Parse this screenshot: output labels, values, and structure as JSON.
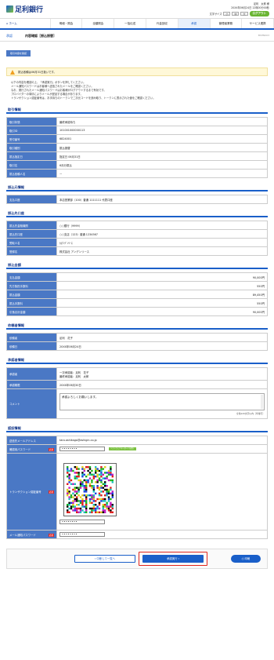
{
  "header": {
    "bank_name": "足利銀行",
    "user_line": "足利　太郎 様",
    "login_line": "20XX年06月24日 12時00分00秒",
    "font_size_label": "文字サイズ",
    "font_small": "小",
    "font_mid": "中",
    "font_large": "大",
    "logout_label": "ログアウト"
  },
  "nav": {
    "home": "ホーム",
    "items": [
      "明細・照会",
      "全額照会",
      "一括伝送",
      "代金回収",
      "承認",
      "管理者業務",
      "サービス連携"
    ]
  },
  "title": {
    "category": "承認",
    "title": "内容確認［振込振替］",
    "code": "BSHN003"
  },
  "step_label": "取引内容を確認",
  "notice": "振込依頼は06月31日扱いです。",
  "intro": [
    "以下の内容を確認の上、「承認実行」ボタンを押してください。",
    "メール通知パスワードはお客様へ送信されたメールをご確認ください。",
    "なお、発行されたメール通知パスワードはお客様がログアウトするまで有効です。",
    "プロバイダーの事情によりメールが遅延する場合があります。",
    "トランザクション認証番号は、お手持ちのトークンで二次元コードを読み取り、トークンに表示された値をご確認ください。"
  ],
  "sections": {
    "txn": {
      "heading": "取引情報",
      "rows": [
        {
          "k": "取引状態",
          "v": "最終承認待ち"
        },
        {
          "k": "取引ID",
          "v": "101001000000113"
        },
        {
          "k": "受付番号",
          "v": "6824001"
        },
        {
          "k": "取引種別",
          "v": "振込振替"
        },
        {
          "k": "振込指定日",
          "v": "指定日 06月31日"
        },
        {
          "k": "取引名",
          "v": "6月分振込"
        },
        {
          "k": "振込依頼人名",
          "v": "ー"
        }
      ]
    },
    "from": {
      "heading": "振込元情報",
      "rows": [
        {
          "k": "支払口座",
          "v": "本店営業部（100）普通 1111111 代表口座"
        }
      ]
    },
    "to": {
      "heading": "振込先口座",
      "rows": [
        {
          "k": "振込先金融機関",
          "v": "○○銀行（9999）"
        },
        {
          "k": "振込先口座",
          "v": "○○支店（123）普通 1234567"
        },
        {
          "k": "受取人名",
          "v": "ｶ)ｱﾝﾃﾞﾝﾘｰｽ"
        },
        {
          "k": "登録名",
          "v": "株式会社 アンデンリース"
        }
      ]
    },
    "amount": {
      "heading": "振込金額",
      "rows": [
        {
          "k": "支払金額",
          "v": "90,000円"
        },
        {
          "k": "先方負担手数料",
          "v": "550円"
        },
        {
          "k": "振込金額",
          "v": "89,450円"
        },
        {
          "k": "振込手数料",
          "v": "550円"
        },
        {
          "k": "引落合計金額",
          "v": "90,000円"
        }
      ]
    },
    "requester": {
      "heading": "依頼者情報",
      "rows": [
        {
          "k": "依頼者",
          "v": "足利　花子"
        },
        {
          "k": "依頼日",
          "v": "20XX年06月24日"
        }
      ]
    },
    "approver": {
      "heading": "承認者情報",
      "approvers_k": "承認者",
      "approvers_v1": "一次承認者：足利　花子",
      "approvers_v2": "最終承認者：足利　太郎",
      "deadline_k": "承認期限",
      "deadline_v": "20XX年06月30日",
      "comment_k": "コメント",
      "comment_v": "承認よろしくお願いします。",
      "chars": "全角120文字以内［半角可］"
    },
    "auth": {
      "heading": "認証情報",
      "email_k": "送信先メールアドレス",
      "email_v": "taro.ashikaga@ashigin.co.jp",
      "pw_k": "確認用パスワード",
      "pw_v": "••••••••",
      "softkey": "ソフトウェアキーボードを開く",
      "token_k": "トランザクション認証番号",
      "token_v": "••••••••",
      "mail_pw_k": "メール通知パスワード",
      "mail_pw_v": "••••••••",
      "required": "必須"
    }
  },
  "buttons": {
    "back": "中断して一覧へ",
    "execute": "承認実行",
    "print": "印刷"
  }
}
